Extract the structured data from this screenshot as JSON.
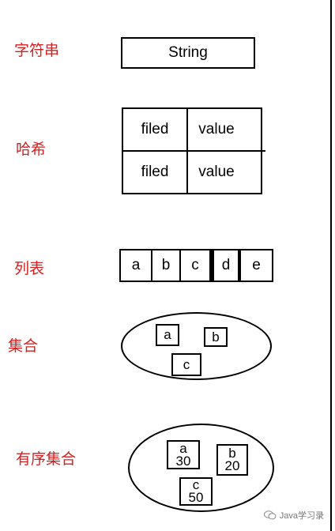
{
  "colors": {
    "label": "#d42020",
    "stroke": "#000000"
  },
  "sections": {
    "string": {
      "label": "字符串",
      "value": "String"
    },
    "hash": {
      "label": "哈希",
      "rows": [
        {
          "field": "filed",
          "value": "value"
        },
        {
          "field": "filed",
          "value": "value"
        }
      ]
    },
    "list": {
      "label": "列表",
      "items": [
        "a",
        "b",
        "c",
        "d",
        "e"
      ]
    },
    "set": {
      "label": "集合",
      "members": [
        "a",
        "b",
        "c"
      ]
    },
    "zset": {
      "label": "有序集合",
      "members": [
        {
          "member": "a",
          "score": "30"
        },
        {
          "member": "b",
          "score": "20"
        },
        {
          "member": "c",
          "score": "50"
        }
      ]
    }
  },
  "watermark": {
    "text": "Java学习录",
    "icon": "wechat-bubble-icon"
  }
}
